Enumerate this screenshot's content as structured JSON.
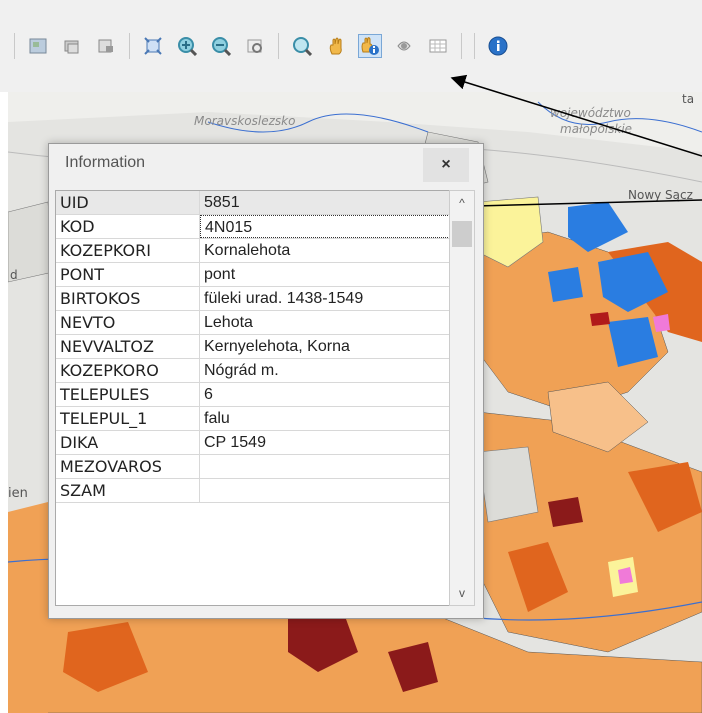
{
  "toolbar": {
    "icons": [
      "select-features-icon",
      "layer-icon",
      "layer-2-icon",
      "zoom-extent-icon",
      "zoom-in-icon",
      "zoom-out-icon",
      "zoom-layer-icon",
      "magnifier-icon",
      "pan-icon",
      "identify-icon",
      "tool-icon",
      "table-icon",
      "info-icon"
    ]
  },
  "map": {
    "labels": {
      "region1": "Moravskoslezsko",
      "region2_line1": "województwo",
      "region2_line2": "małopolskie",
      "city": "Nowy Sącz",
      "edge_label1": "d",
      "edge_label2": "ien",
      "edge_label3": "ta"
    }
  },
  "info_window": {
    "title": "Information",
    "close_label": "×",
    "rows": [
      {
        "key": "UID",
        "value": "5851"
      },
      {
        "key": "KOD",
        "value": "4N015"
      },
      {
        "key": "KOZEPKORI",
        "value": "Kornalehota"
      },
      {
        "key": "PONT",
        "value": "pont"
      },
      {
        "key": "BIRTOKOS",
        "value": "füleki urad. 1438-1549"
      },
      {
        "key": "NEVTO",
        "value": "Lehota"
      },
      {
        "key": "NEVVALTOZ",
        "value": "Kernyelehota, Korna"
      },
      {
        "key": "KOZEPKORO",
        "value": "Nógrád m."
      },
      {
        "key": "TELEPULES",
        "value": "6"
      },
      {
        "key": "TELEPUL_1",
        "value": "falu"
      },
      {
        "key": "DIKA",
        "value": "CP 1549"
      },
      {
        "key": "MEZOVAROS",
        "value": ""
      },
      {
        "key": "SZAM",
        "value": ""
      }
    ],
    "scroll_up": "^",
    "scroll_down": "v"
  },
  "colors": {
    "polygon_orange": "#f0a155",
    "polygon_dark_orange": "#e0651e",
    "polygon_maroon": "#8b1a1a",
    "polygon_blue": "#2a7de1",
    "polygon_yellow": "#fbf39a",
    "polygon_pink": "#f07ad8"
  }
}
